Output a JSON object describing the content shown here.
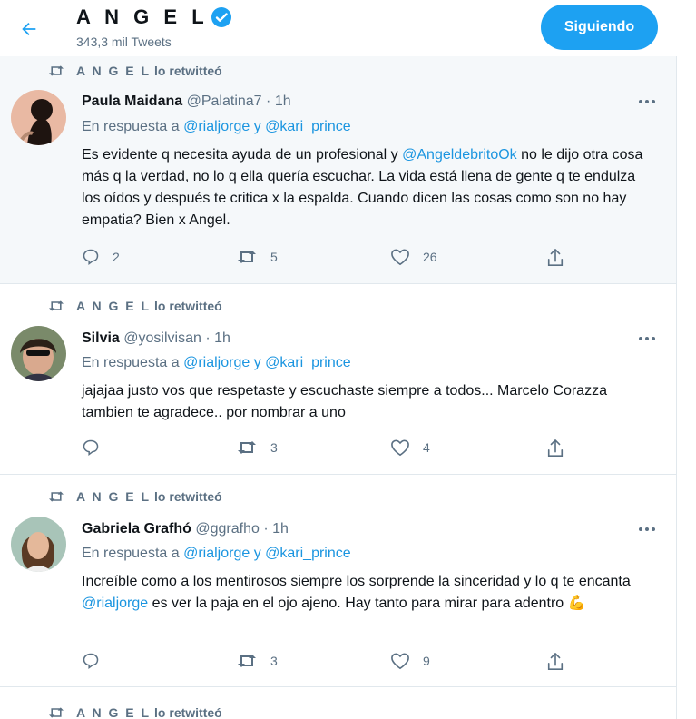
{
  "header": {
    "title": "A N G E L",
    "tweet_count": "343,3 mil Tweets",
    "follow_label": "Siguiendo"
  },
  "retweet_label": "lo retwitteó",
  "retweeter": "A N G E L",
  "reply_prefix": "En respuesta a",
  "reply_conj": "y",
  "tweets": [
    {
      "name": "Paula Maidana",
      "handle": "@Palatina7",
      "time": "1h",
      "reply_to": [
        "@rialjorge",
        "@kari_prince"
      ],
      "text_a": "Es evidente q necesita ayuda de un profesional y ",
      "mention": "@AngeldebritoOk",
      "text_b": " no le dijo otra cosa más q la verdad, no lo q ella quería escuchar. La vida está llena de gente q te endulza los oídos y después te critica x la espalda. Cuando dicen las cosas como son no hay empatia? Bien x Angel.",
      "replies": "2",
      "retweets": "5",
      "likes": "26"
    },
    {
      "name": "Silvia",
      "handle": "@yosilvisan",
      "time": "1h",
      "reply_to": [
        "@rialjorge",
        "@kari_prince"
      ],
      "text_a": "jajajaa justo vos que respetaste y escuchaste siempre a todos... Marcelo Corazza tambien te agradece.. por nombrar a uno",
      "mention": "",
      "text_b": "",
      "replies": "",
      "retweets": "3",
      "likes": "4"
    },
    {
      "name": "Gabriela Grafhó",
      "handle": "@ggrafho",
      "time": "1h",
      "reply_to": [
        "@rialjorge",
        "@kari_prince"
      ],
      "text_a": "Increíble como a los mentirosos siempre los sorprende la sinceridad y lo q te encanta ",
      "mention": "@rialjorge",
      "text_b": " es ver la paja en el ojo ajeno. Hay tanto para mirar para adentro ",
      "emoji": "💪",
      "replies": "",
      "retweets": "3",
      "likes": "9"
    }
  ],
  "colors": {
    "accent": "#1da1f2",
    "link": "#1b95e0",
    "muted": "#5b7083",
    "highlight_bg": "#f5f8fa"
  }
}
